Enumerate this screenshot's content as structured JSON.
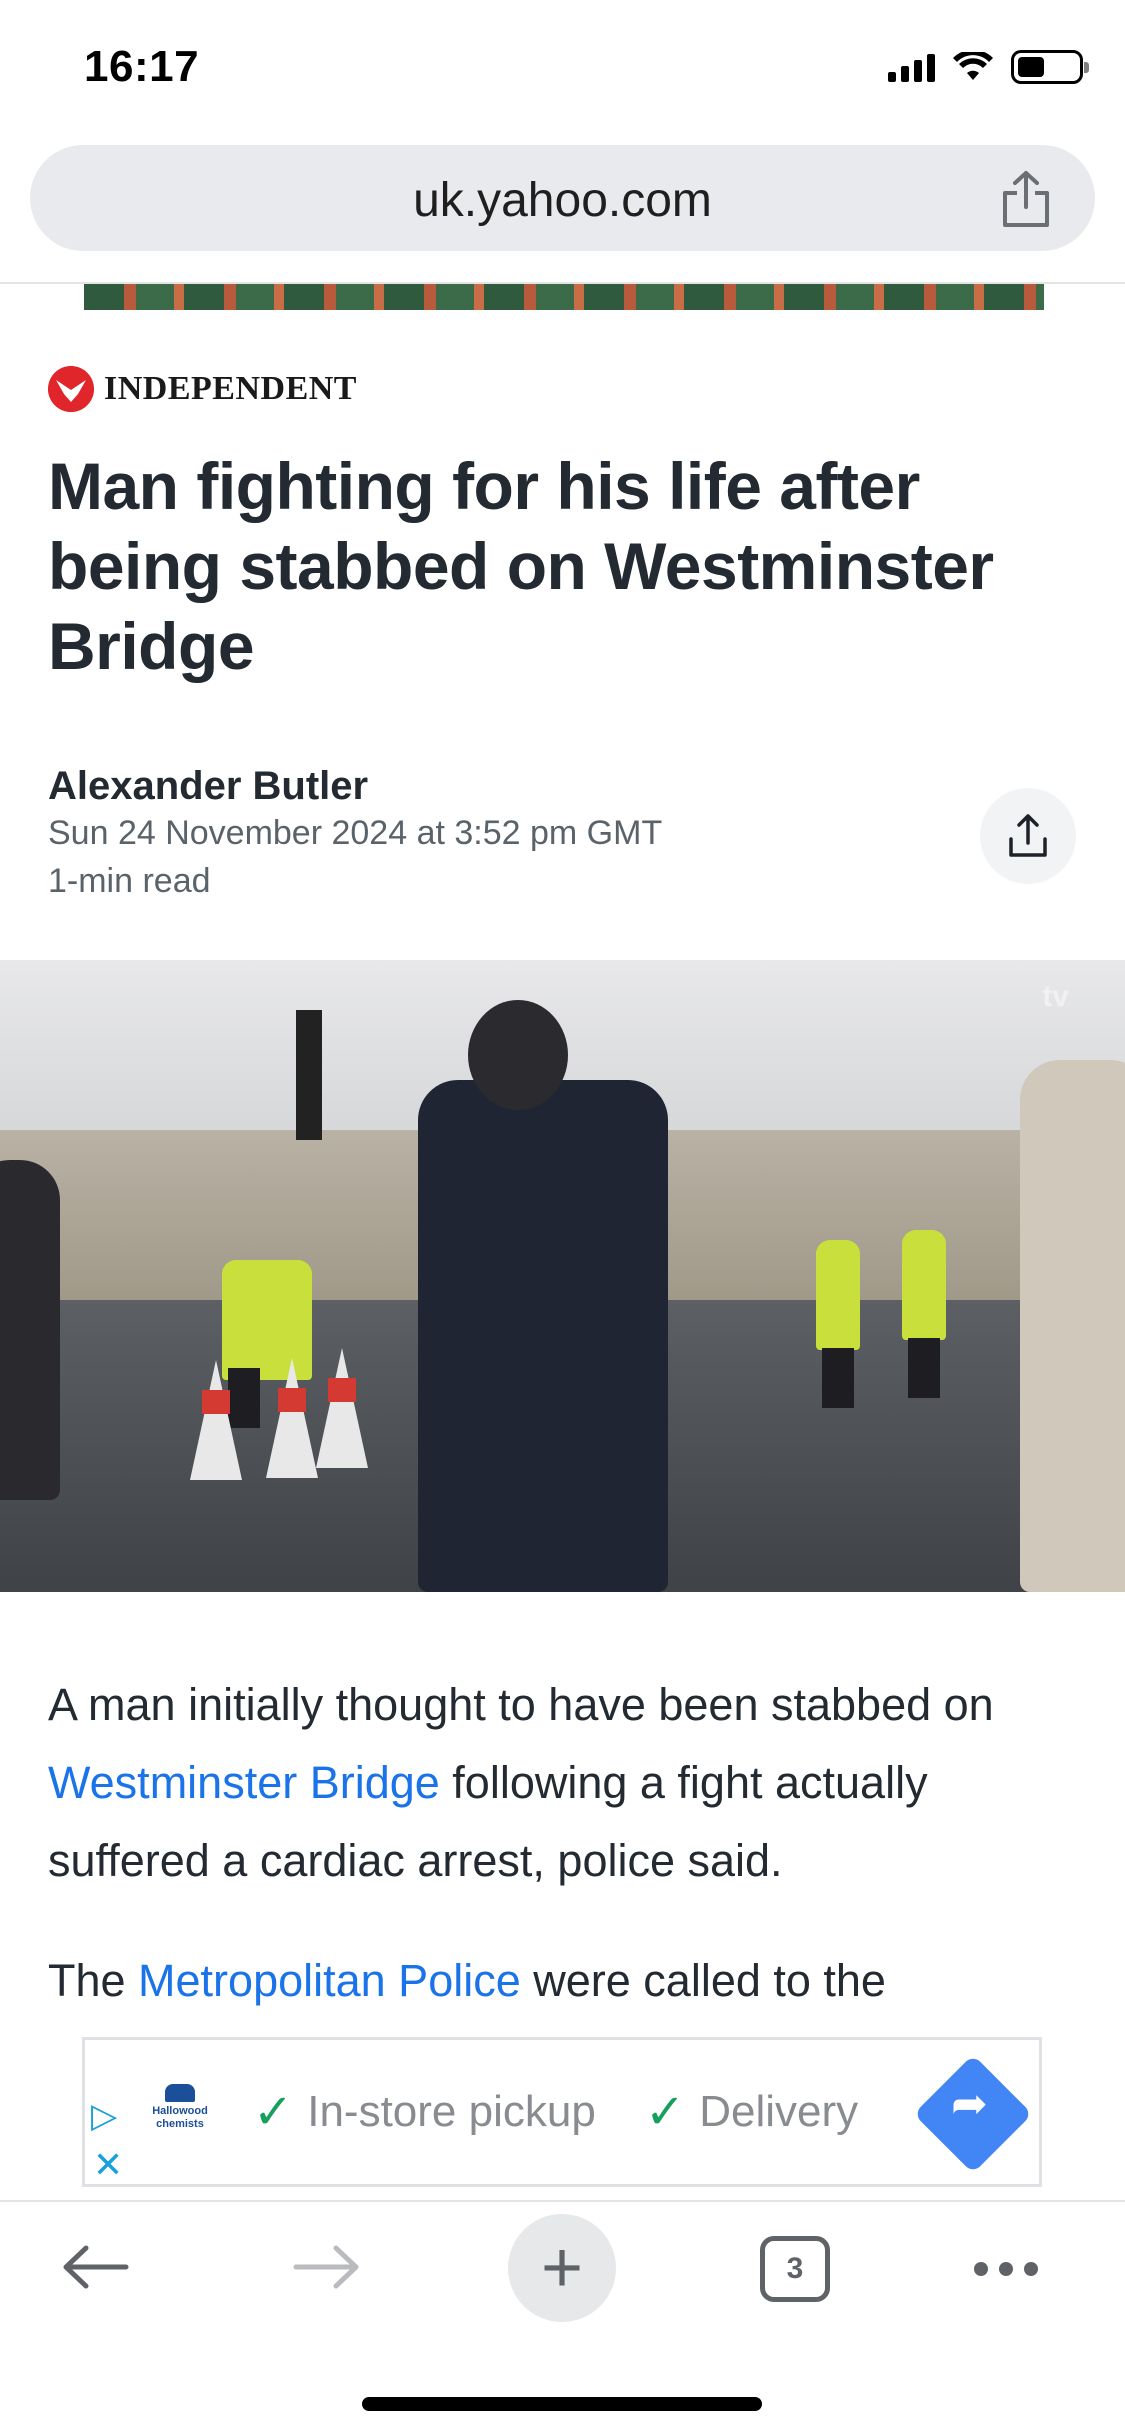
{
  "status_bar": {
    "time": "16:17"
  },
  "browser": {
    "url": "uk.yahoo.com",
    "open_tabs": "3"
  },
  "article": {
    "publisher": "INDEPENDENT",
    "headline": "Man fighting for his life after being stabbed on Westminster Bridge",
    "author": "Alexander Butler",
    "date": "Sun 24 November 2024 at 3:52 pm GMT",
    "read_time": "1-min read",
    "video_watermark": "tv",
    "p1_before": "A man initially thought to have been stabbed on ",
    "p1_link": "Westminster Bridge",
    "p1_after": " following a fight actually suffered a cardiac arrest, police said.",
    "p2_before": "The ",
    "p2_link": "Metropolitan Police",
    "p2_after": " were called to the"
  },
  "ad": {
    "advertiser": "Hallowood chemists",
    "feature_1": "In-store pickup",
    "feature_2": "Delivery"
  },
  "colors": {
    "link": "#1a73e8",
    "ad_cta": "#4285f4",
    "publisher_red": "#e0262b",
    "check_green": "#17a05d"
  }
}
